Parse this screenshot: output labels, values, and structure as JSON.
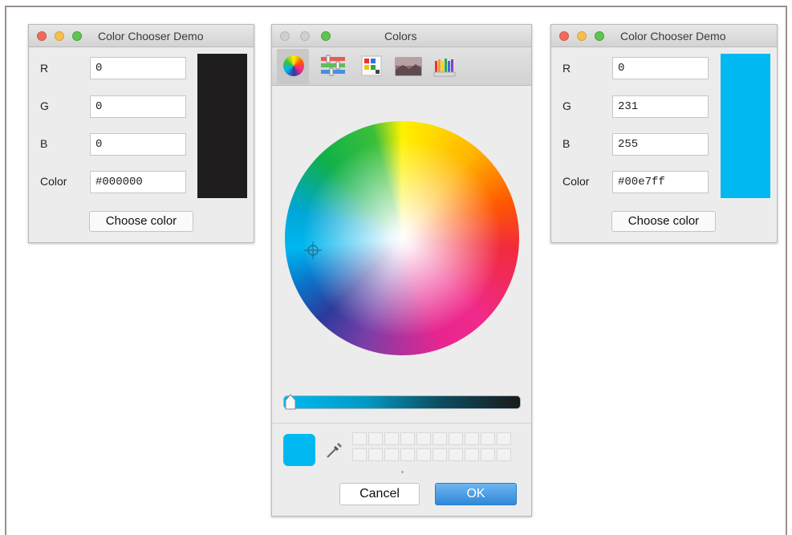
{
  "left_window": {
    "title": "Color Chooser Demo",
    "r_label": "R",
    "r_value": "0",
    "g_label": "G",
    "g_value": "0",
    "b_label": "B",
    "b_value": "0",
    "color_label": "Color",
    "color_value": "#000000",
    "button": "Choose color",
    "swatch_color": "#1f1d1e"
  },
  "colors_panel": {
    "title": "Colors",
    "toolbar": [
      "color-wheel-icon",
      "sliders-icon",
      "palettes-icon",
      "image-palette-icon",
      "crayons-icon"
    ],
    "current_color": "#00b9f1",
    "cancel": "Cancel",
    "ok": "OK"
  },
  "right_window": {
    "title": "Color Chooser Demo",
    "r_label": "R",
    "r_value": "0",
    "g_label": "G",
    "g_value": "231",
    "b_label": "B",
    "b_value": "255",
    "color_label": "Color",
    "color_value": "#00e7ff",
    "button": "Choose color",
    "swatch_color": "#00b9f1"
  }
}
